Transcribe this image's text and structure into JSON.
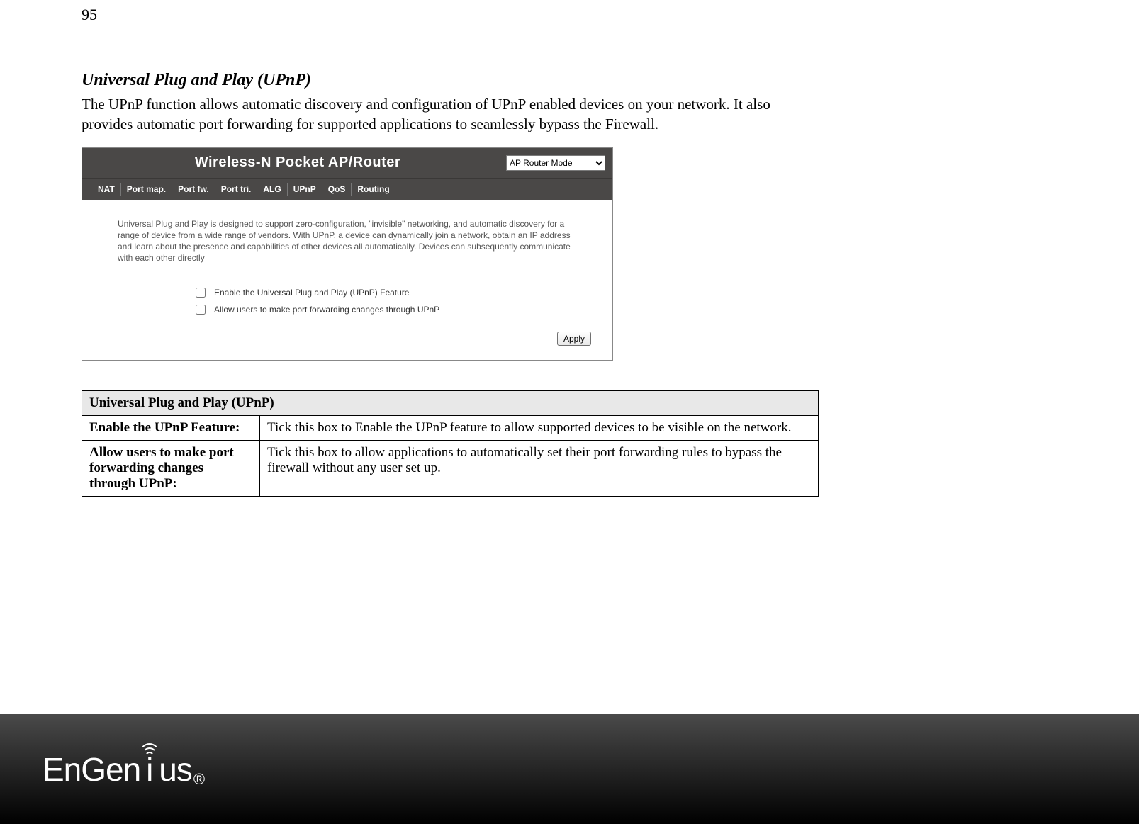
{
  "page_number": "95",
  "section": {
    "title": "Universal Plug and Play (UPnP)",
    "description": "The UPnP function allows automatic discovery and configuration of UPnP enabled devices on your network. It also provides automatic port forwarding for supported applications to seamlessly bypass the Firewall."
  },
  "router_panel": {
    "title": "Wireless-N Pocket AP/Router",
    "mode_selected": "AP Router Mode",
    "tabs": [
      "NAT",
      "Port map.",
      "Port fw.",
      "Port tri.",
      "ALG",
      "UPnP",
      "QoS",
      "Routing"
    ],
    "description": "Universal Plug and Play is designed to support zero-configuration, \"invisible\" networking, and automatic discovery for a range of device from a wide range of vendors. With UPnP, a device can dynamically join a network, obtain an IP address and learn about the presence and capabilities of other devices all automatically. Devices can subsequently communicate with each other directly",
    "options": {
      "enable_label": "Enable the Universal Plug and Play (UPnP) Feature",
      "allow_label": "Allow users to make port forwarding changes through UPnP"
    },
    "apply_label": "Apply"
  },
  "info_table": {
    "header": "Universal Plug and Play (UPnP)",
    "rows": [
      {
        "label": "Enable the UPnP Feature:",
        "desc": "Tick this box to Enable the UPnP feature to allow supported devices to be visible on the network."
      },
      {
        "label": "Allow users to make port forwarding changes through UPnP:",
        "desc": "Tick this box to allow applications to automatically set their port forwarding rules to bypass the firewall without any user set up."
      }
    ]
  },
  "footer": {
    "brand_part1": "EnGen",
    "brand_i": "i",
    "brand_part2": "us",
    "registered": "®"
  }
}
